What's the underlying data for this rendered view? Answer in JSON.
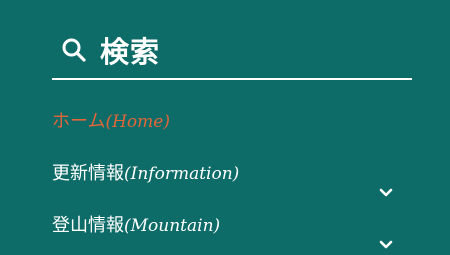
{
  "search": {
    "label": "検索",
    "icon": "search-icon"
  },
  "menu": {
    "items": [
      {
        "label": "ホーム",
        "en": "(Home)",
        "active": true,
        "accent": "#e0673a",
        "has_submenu": false
      },
      {
        "label": "更新情報",
        "en": "(Information)",
        "active": false,
        "has_submenu": true,
        "icon": "chevron-down-icon"
      },
      {
        "label": "登山情報",
        "en": "(Mountain)",
        "active": false,
        "has_submenu": true,
        "icon": "chevron-down-icon"
      }
    ]
  },
  "colors": {
    "background": "#0d6b68",
    "text": "#ffffff",
    "accent": "#e0673a"
  }
}
